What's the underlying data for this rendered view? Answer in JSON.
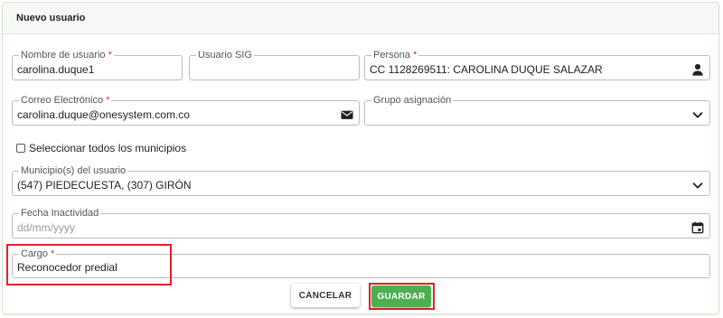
{
  "card": {
    "title": "Nuevo usuario"
  },
  "fields": {
    "username": {
      "label": "Nombre de usuario",
      "required": "*",
      "value": "carolina.duque1"
    },
    "sig_user": {
      "label": "Usuario SIG",
      "value": ""
    },
    "persona": {
      "label": "Persona",
      "required": "*",
      "value": "CC 1128269511: CAROLINA DUQUE SALAZAR",
      "icon": "user-icon"
    },
    "email": {
      "label": "Correo Electrónico",
      "required": "*",
      "value": "carolina.duque@onesystem.com.co",
      "icon": "envelope-icon"
    },
    "group": {
      "label": "Grupo asignación",
      "value": "",
      "icon": "chevron-down-icon"
    },
    "municipios": {
      "label": "Municipio(s) del usuario",
      "value": "(547) PIEDECUESTA, (307) GIRÓN",
      "icon": "chevron-down-icon"
    },
    "inactive_date": {
      "label": "Fecha Inactividad",
      "placeholder": "dd/mm/yyyy",
      "icon": "calendar-icon"
    },
    "cargo": {
      "label": "Cargo",
      "required": "*",
      "value": "Reconocedor predial"
    }
  },
  "select_all": {
    "label": "Seleccionar todos los municipios",
    "checked": false
  },
  "buttons": {
    "cancel": "CANCELAR",
    "save": "GUARDAR"
  },
  "colors": {
    "required": "#d32f2f",
    "highlight": "#e0212b",
    "save": "#4caf50"
  }
}
